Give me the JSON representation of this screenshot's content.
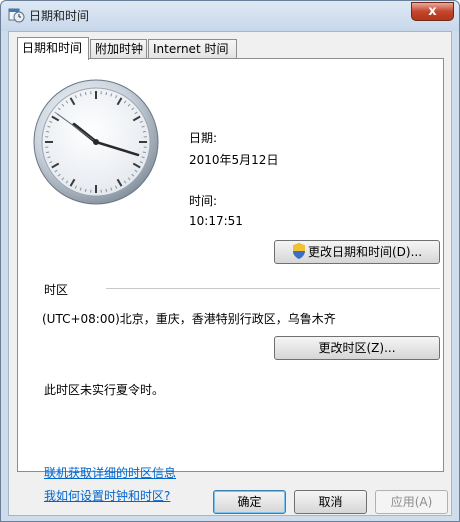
{
  "window": {
    "title": "日期和时间",
    "close_glyph": "x"
  },
  "tabs": [
    {
      "label": "日期和时间",
      "active": true
    },
    {
      "label": "附加时钟",
      "active": false
    },
    {
      "label": "Internet 时间",
      "active": false
    }
  ],
  "date_time": {
    "date_label": "日期:",
    "date_value": "2010年5月12日",
    "time_label": "时间:",
    "time_value": "10:17:51",
    "change_button": "更改日期和时间(D)..."
  },
  "timezone": {
    "section_label": "时区",
    "current": "(UTC+08:00)北京，重庆，香港特别行政区，乌鲁木齐",
    "change_button": "更改时区(Z)...",
    "dst_note": "此时区未实行夏令时。"
  },
  "links": {
    "online_info": "联机获取详细的时区信息",
    "how_to": "我如何设置时钟和时区?"
  },
  "footer": {
    "ok": "确定",
    "cancel": "取消",
    "apply": "应用(A)"
  },
  "clock": {
    "hour": 10,
    "minute": 17,
    "second": 51
  }
}
